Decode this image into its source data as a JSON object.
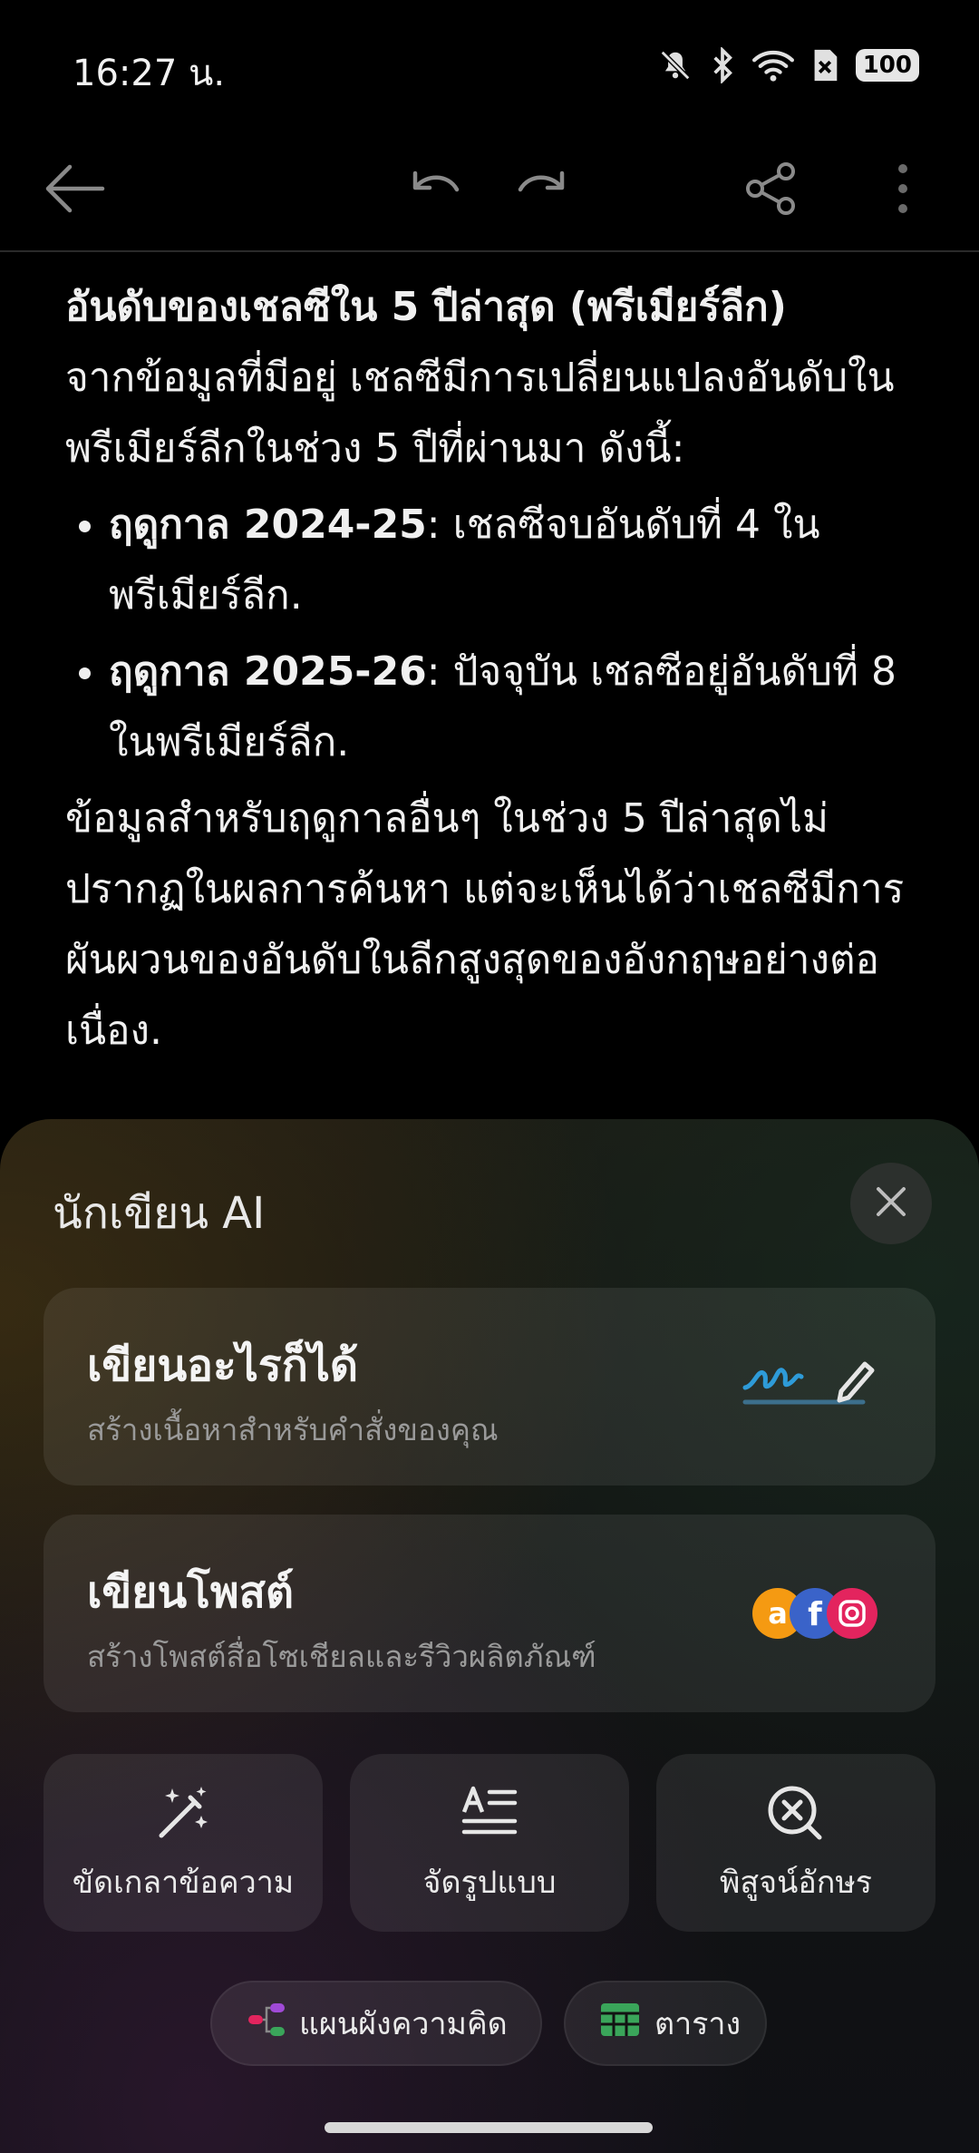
{
  "status_bar": {
    "time": "16:27 น.",
    "battery": "100"
  },
  "toolbar": {
    "back_icon": "back-arrow-icon",
    "undo_icon": "undo-icon",
    "redo_icon": "redo-icon",
    "share_icon": "share-icon",
    "more_icon": "more-vertical-icon"
  },
  "article": {
    "heading": "อันดับของเชลซีใน 5 ปีล่าสุด (พรีเมียร์ลีก)",
    "intro": "จากข้อมูลที่มีอยู่ เชลซีมีการเปลี่ยนแปลงอันดับในพรีเมียร์ลีกในช่วง 5 ปีที่ผ่านมา ดังนี้:",
    "bullets": [
      {
        "term": "ฤดูกาล 2024-25",
        "text": ": เชลซีจบอันดับที่ 4 ในพรีเมียร์ลีก."
      },
      {
        "term": "ฤดูกาล 2025-26",
        "text": ": ปัจจุบัน เชลซีอยู่อันดับที่ 8 ในพรีเมียร์ลีก."
      }
    ],
    "conclusion": "ข้อมูลสำหรับฤดูกาลอื่นๆ ในช่วง 5 ปีล่าสุดไม่ปรากฏในผลการค้นหา แต่จะเห็นได้ว่าเชลซีมีการผันผวนของอันดับในลีกสูงสุดของอังกฤษอย่างต่อเนื่อง."
  },
  "ai_panel": {
    "title": "นักเขียน AI",
    "cards": [
      {
        "title": "เขียนอะไรก็ได้",
        "subtitle": "สร้างเนื้อหาสำหรับคำสั่งของคุณ",
        "icon": "handwriting-pen-icon"
      },
      {
        "title": "เขียนโพสต์",
        "subtitle": "สร้างโพสต์สื่อโซเชียลและรีวิวผลิตภัณฑ์",
        "icon": "social-media-icons"
      }
    ],
    "tools": [
      {
        "label": "ขัดเกลาข้อความ",
        "icon": "magic-wand-icon"
      },
      {
        "label": "จัดรูปแบบ",
        "icon": "text-format-icon"
      },
      {
        "label": "พิสูจน์อักษร",
        "icon": "proofread-icon"
      }
    ],
    "pills": [
      {
        "label": "แผนผังความคิด",
        "icon": "mind-map-icon"
      },
      {
        "label": "ตาราง",
        "icon": "table-icon"
      }
    ],
    "colors": {
      "accent_blue": "#2e9bd8",
      "amazon": "#f59a12",
      "facebook": "#3a63c9",
      "instagram": "#e3245e",
      "table_green": "#3aa55a"
    }
  }
}
